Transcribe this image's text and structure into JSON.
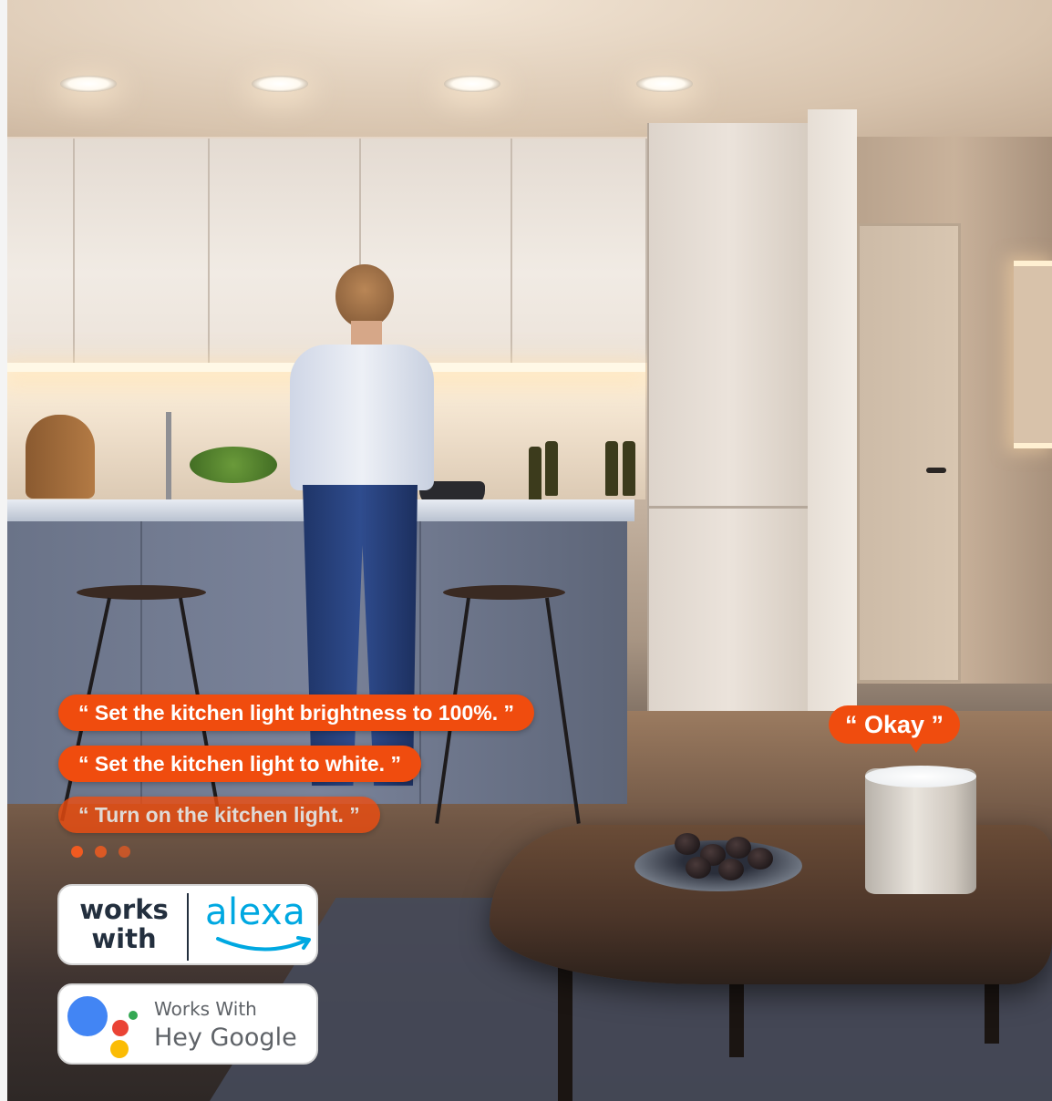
{
  "voice_commands": [
    {
      "text": "“ Set the kitchen light brightness to 100%. ”"
    },
    {
      "text": "“ Set the kitchen light to white. ”"
    },
    {
      "text": "“ Turn on the kitchen light. ”"
    }
  ],
  "speaker_reply": {
    "text": "“ Okay ”"
  },
  "badges": {
    "alexa": {
      "line1": "works",
      "line2": "with",
      "brand": "alexa",
      "brand_color": "#00a8e1"
    },
    "google": {
      "line1": "Works With",
      "line2": "Hey Google"
    }
  },
  "colors": {
    "bubble": "#f04c0e",
    "google_blue": "#4285f4",
    "google_red": "#ea4335",
    "google_yellow": "#fbbc04",
    "google_green": "#34a853"
  },
  "icons": [
    "amazon-smile-icon",
    "google-assistant-icon",
    "typing-dots-icon"
  ]
}
